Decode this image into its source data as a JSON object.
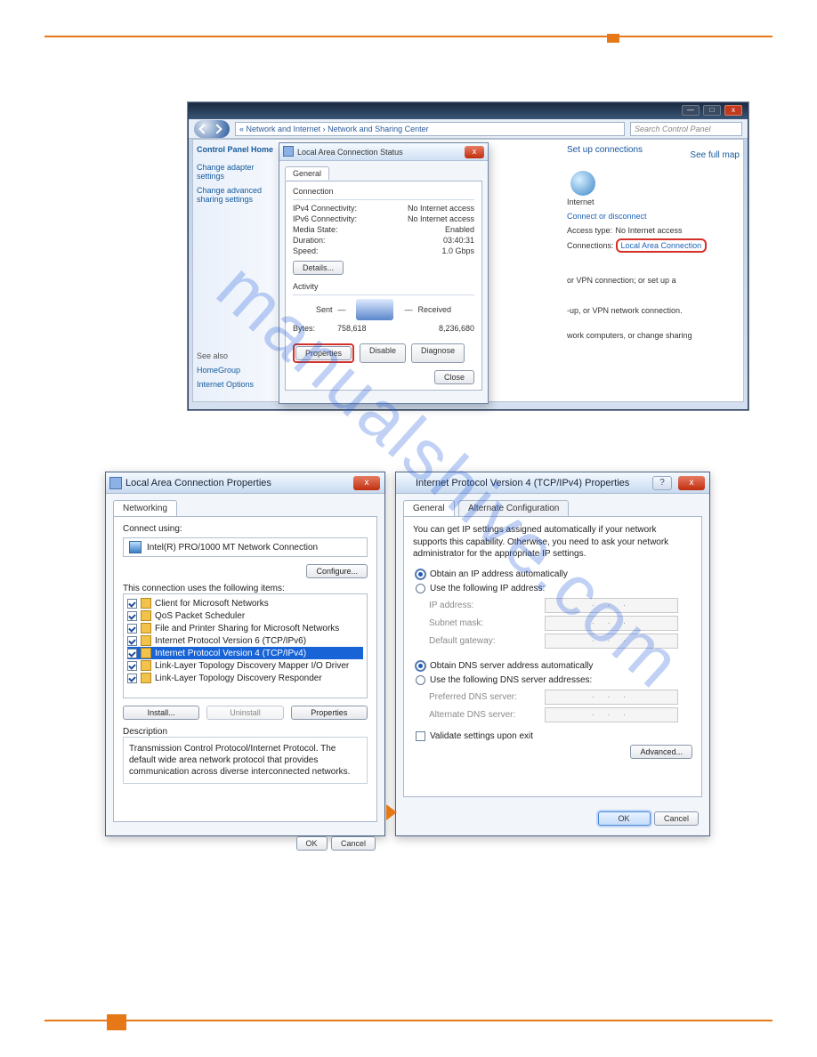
{
  "top_window": {
    "title_buttons": {
      "min": "—",
      "max": "□",
      "close": "x"
    },
    "breadcrumb_prefix": "«",
    "breadcrumb1": "Network and Internet",
    "breadcrumb_sep": "›",
    "breadcrumb2": "Network and Sharing Center",
    "search_placeholder": "Search Control Panel",
    "left": {
      "cph": "Control Panel Home",
      "link1": "Change adapter settings",
      "link2": "Change advanced sharing settings",
      "seealso": "See also",
      "hg": "HomeGroup",
      "io": "Internet Options"
    },
    "right": {
      "heading": "Set up connections",
      "seefullmap": "See full map",
      "internet": "Internet",
      "connect_disconnect": "Connect or disconnect",
      "access_type_lbl": "Access type:",
      "access_type_val": "No Internet access",
      "connections_lbl": "Connections:",
      "lac_link": "Local Area Connection",
      "line1": "or VPN connection; or set up a",
      "line2": "-up, or VPN network connection.",
      "line3": "work computers, or change sharing"
    },
    "status": {
      "title": "Local Area Connection Status",
      "close": "x",
      "tab": "General",
      "grp_conn": "Connection",
      "kv": [
        {
          "k": "IPv4 Connectivity:",
          "v": "No Internet access"
        },
        {
          "k": "IPv6 Connectivity:",
          "v": "No Internet access"
        },
        {
          "k": "Media State:",
          "v": "Enabled"
        },
        {
          "k": "Duration:",
          "v": "03:40:31"
        },
        {
          "k": "Speed:",
          "v": "1.0 Gbps"
        }
      ],
      "details": "Details...",
      "grp_act": "Activity",
      "sent": "Sent",
      "received": "Received",
      "bytes_lbl": "Bytes:",
      "bytes_sent": "758,618",
      "bytes_recv": "8,236,680",
      "properties": "Properties",
      "disable": "Disable",
      "diagnose": "Diagnose",
      "closebtn": "Close"
    }
  },
  "props": {
    "title": "Local Area Connection Properties",
    "close": "x",
    "tab": "Networking",
    "connect_using": "Connect using:",
    "adapter": "Intel(R) PRO/1000 MT Network Connection",
    "configure": "Configure...",
    "list_label": "This connection uses the following items:",
    "items": [
      "Client for Microsoft Networks",
      "QoS Packet Scheduler",
      "File and Printer Sharing for Microsoft Networks",
      "Internet Protocol Version 6 (TCP/IPv6)",
      "Internet Protocol Version 4 (TCP/IPv4)",
      "Link-Layer Topology Discovery Mapper I/O Driver",
      "Link-Layer Topology Discovery Responder"
    ],
    "install": "Install...",
    "uninstall": "Uninstall",
    "properties": "Properties",
    "desc_label": "Description",
    "desc": "Transmission Control Protocol/Internet Protocol. The default wide area network protocol that provides communication across diverse interconnected networks.",
    "ok": "OK",
    "cancel": "Cancel"
  },
  "tcp": {
    "title": "Internet Protocol Version 4 (TCP/IPv4) Properties",
    "help": "?",
    "close": "x",
    "tab1": "General",
    "tab2": "Alternate Configuration",
    "intro": "You can get IP settings assigned automatically if your network supports this capability. Otherwise, you need to ask your network administrator for the appropriate IP settings.",
    "r_auto_ip": "Obtain an IP address automatically",
    "r_man_ip": "Use the following IP address:",
    "ip": "IP address:",
    "subnet": "Subnet mask:",
    "gateway": "Default gateway:",
    "r_auto_dns": "Obtain DNS server address automatically",
    "r_man_dns": "Use the following DNS server addresses:",
    "pref_dns": "Preferred DNS server:",
    "alt_dns": "Alternate DNS server:",
    "ip_placeholder": ".   .   .",
    "validate": "Validate settings upon exit",
    "advanced": "Advanced...",
    "ok": "OK",
    "cancel": "Cancel"
  },
  "watermark": "manualshive.com"
}
